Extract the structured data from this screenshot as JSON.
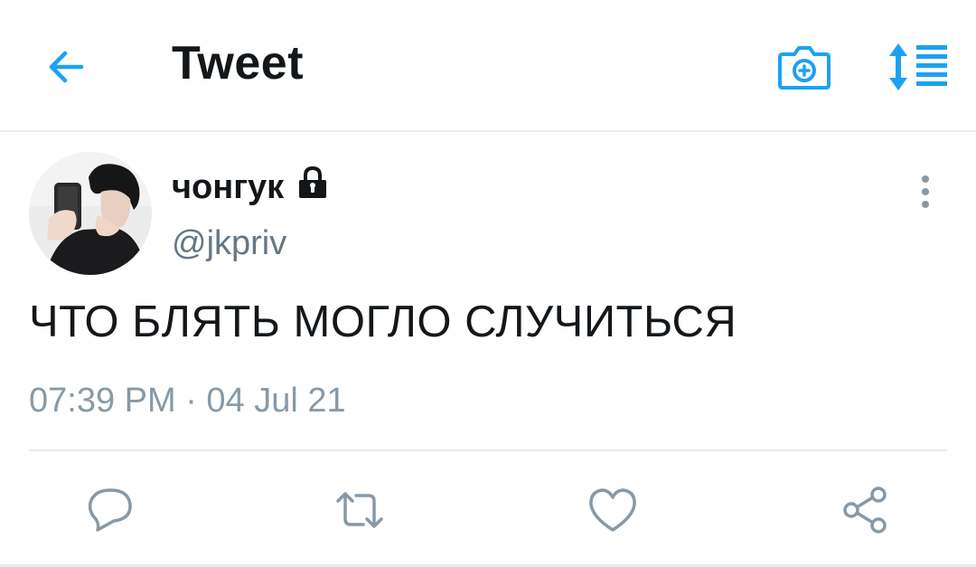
{
  "header": {
    "title": "Tweet",
    "back_icon": "arrow-left-icon",
    "camera_icon": "camera-plus-icon",
    "sort_icon": "sort-list-icon"
  },
  "tweet": {
    "display_name": "чонгук",
    "protected_icon": "lock-icon",
    "handle": "@jkpriv",
    "text": "ЧТО БЛЯТЬ МОГЛО СЛУЧИТЬСЯ",
    "timestamp": "07:39 PM · 04 Jul 21"
  },
  "actions": {
    "reply_icon": "reply-icon",
    "retweet_icon": "retweet-icon",
    "like_icon": "heart-icon",
    "share_icon": "share-icon"
  },
  "colors": {
    "accent": "#1da1f2",
    "text": "#14171a",
    "secondary": "#657786",
    "icon_gray": "#8899a6",
    "divider": "#e6ecf0"
  }
}
